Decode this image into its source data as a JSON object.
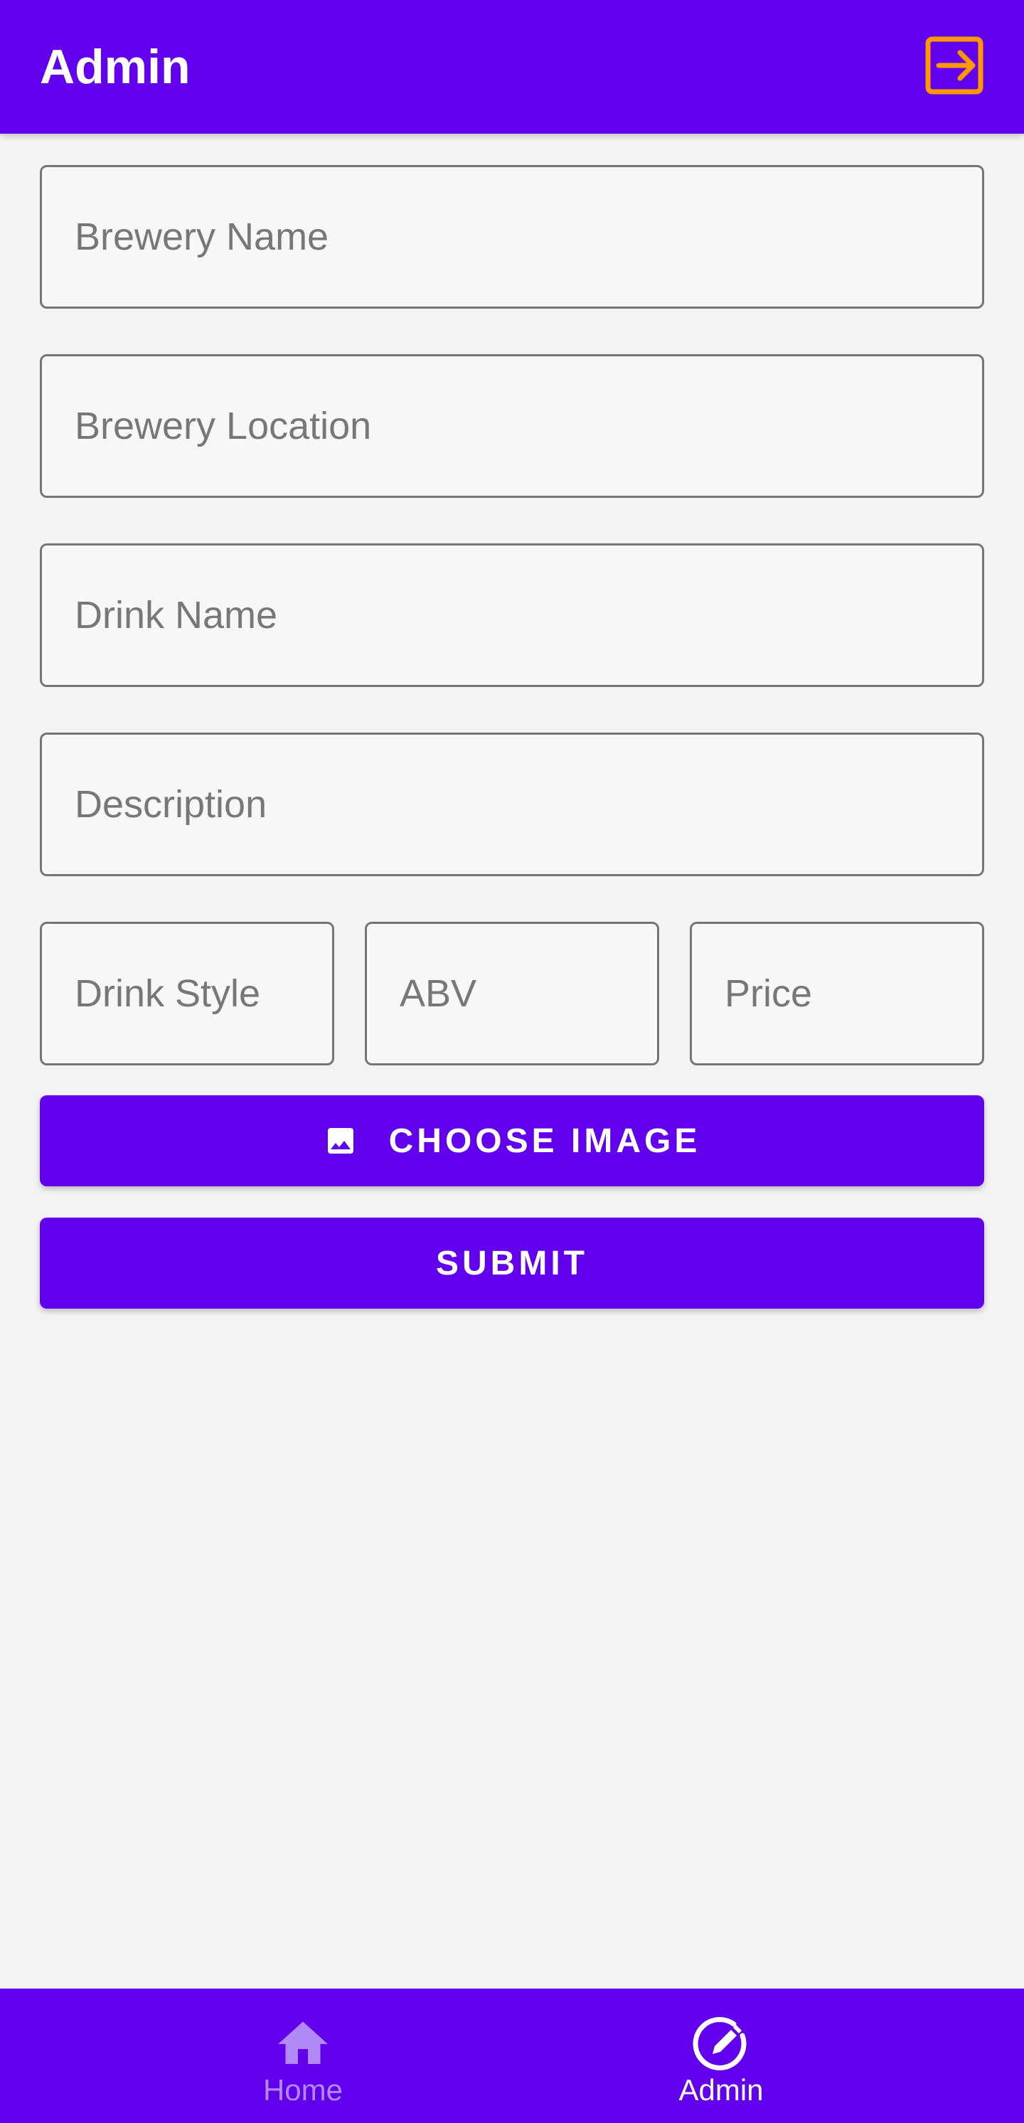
{
  "header": {
    "title": "Admin",
    "logout_icon": "logout-icon",
    "logout_color": "#FF9800"
  },
  "form": {
    "brewery_name": {
      "placeholder": "Brewery Name",
      "value": ""
    },
    "brewery_location": {
      "placeholder": "Brewery Location",
      "value": ""
    },
    "drink_name": {
      "placeholder": "Drink Name",
      "value": ""
    },
    "description": {
      "placeholder": "Description",
      "value": ""
    },
    "drink_style": {
      "placeholder": "Drink Style",
      "value": ""
    },
    "abv": {
      "placeholder": "ABV",
      "value": ""
    },
    "price": {
      "placeholder": "Price",
      "value": ""
    }
  },
  "buttons": {
    "choose_image_label": "CHOOSE IMAGE",
    "choose_image_icon": "image-icon",
    "submit_label": "SUBMIT"
  },
  "bottom_nav": {
    "items": [
      {
        "label": "Home",
        "icon": "home-icon",
        "active": false
      },
      {
        "label": "Admin",
        "icon": "edit-circle-icon",
        "active": true
      }
    ]
  },
  "colors": {
    "primary": "#6200EE",
    "background": "#F3F3F3",
    "accent": "#FF9800",
    "inactive_nav": "#B18AF5"
  }
}
